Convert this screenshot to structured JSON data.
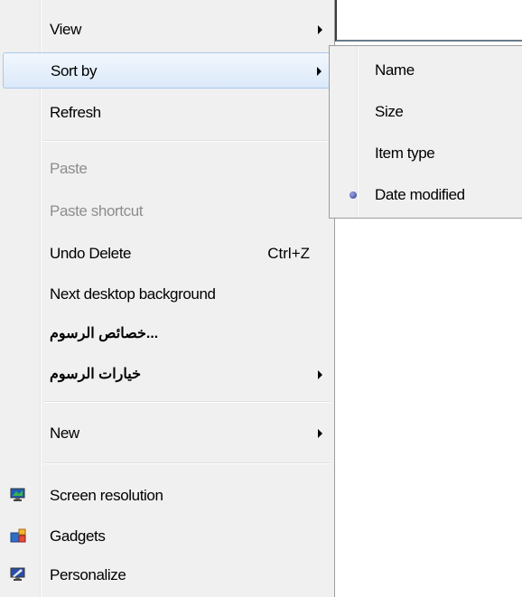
{
  "context_menu": {
    "items": [
      {
        "label": "View"
      },
      {
        "label": "Sort by"
      },
      {
        "label": "Refresh"
      },
      {
        "label": "Paste"
      },
      {
        "label": "Paste shortcut"
      },
      {
        "label": "Undo Delete",
        "shortcut": "Ctrl+Z"
      },
      {
        "label": "Next desktop background"
      },
      {
        "label": "...خصائص الرسوم"
      },
      {
        "label": "خيارات الرسوم"
      },
      {
        "label": "New"
      },
      {
        "label": "Screen resolution",
        "icon": "monitor-icon"
      },
      {
        "label": "Gadgets",
        "icon": "gadgets-icon"
      },
      {
        "label": "Personalize",
        "icon": "personalize-icon"
      }
    ]
  },
  "sort_submenu": {
    "items": [
      {
        "label": "Name"
      },
      {
        "label": "Size"
      },
      {
        "label": "Item type"
      },
      {
        "label": "Date modified",
        "selected": true
      }
    ]
  },
  "colors": {
    "menu_background": "#f0f0f0",
    "hover_border": "#a8c8eb",
    "disabled_text": "#8d8d8d"
  }
}
